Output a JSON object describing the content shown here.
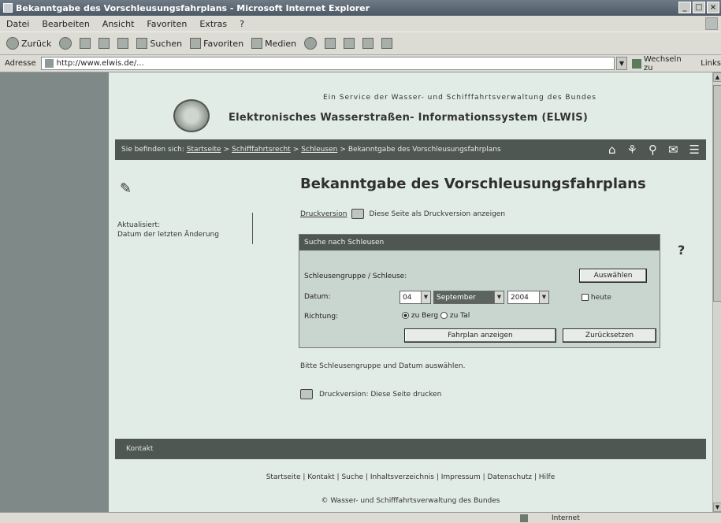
{
  "window": {
    "title": "Bekanntgabe des Vorschleusungsfahrplans - Microsoft Internet Explorer",
    "min": "_",
    "max": "□",
    "close": "×"
  },
  "menubar": [
    "Datei",
    "Bearbeiten",
    "Ansicht",
    "Favoriten",
    "Extras",
    "?"
  ],
  "toolbar": {
    "back": "Zurück",
    "forward": "",
    "search": "Suchen",
    "favorites": "Favoriten",
    "media": "Medien"
  },
  "addressbar": {
    "label": "Adresse",
    "url": "http://www.elwis.de/...",
    "go": "Wechseln zu",
    "links": "Links"
  },
  "leftnav": [
    "",
    "",
    "",
    "",
    "",
    "",
    "",
    "",
    "",
    ""
  ],
  "header": {
    "subtitle": "Ein Service der Wasser- und Schifffahrtsverwaltung des Bundes",
    "title": "Elektronisches Wasserstraßen- Informationssystem (ELWIS)"
  },
  "breadcrumb": {
    "prefix": "Sie befinden sich:",
    "items": [
      "Startseite",
      "Schifffahrtsrecht",
      "Schleusen"
    ],
    "current": "Bekanntgabe des Vorschleusungsfahrplans"
  },
  "sidebar": {
    "lines": [
      "Aktualisiert:",
      "Datum der letzten Änderung"
    ]
  },
  "main": {
    "title": "Bekanntgabe des Vorschleusungsfahrplans",
    "print_text": "Druckversion",
    "print_note": "Diese Seite als Druckversion anzeigen"
  },
  "search_panel": {
    "heading": "Suche nach Schleusen",
    "label_lock": "Schleusengruppe / Schleuse:",
    "choose_button": "Auswählen",
    "label_date": "Datum:",
    "day": "04",
    "month": "September",
    "year": "2004",
    "checkbox_label": "heute",
    "label_direction": "Richtung:",
    "dir_up": "zu Berg",
    "dir_down": "zu Tal",
    "submit_button": "Fahrplan anzeigen",
    "reset_button": "Zurücksetzen"
  },
  "notes": {
    "line1": "Bitte Schleusengruppe und Datum auswählen.",
    "print_line": "Druckversion: Diese Seite drucken"
  },
  "footer": {
    "bar_text": "Kontakt",
    "links": "Startseite | Kontakt | Suche | Inhaltsverzeichnis | Impressum | Datenschutz | Hilfe",
    "note": "© Wasser- und Schifffahrtsverwaltung des Bundes"
  },
  "status": {
    "left": "",
    "zone": "Internet"
  }
}
